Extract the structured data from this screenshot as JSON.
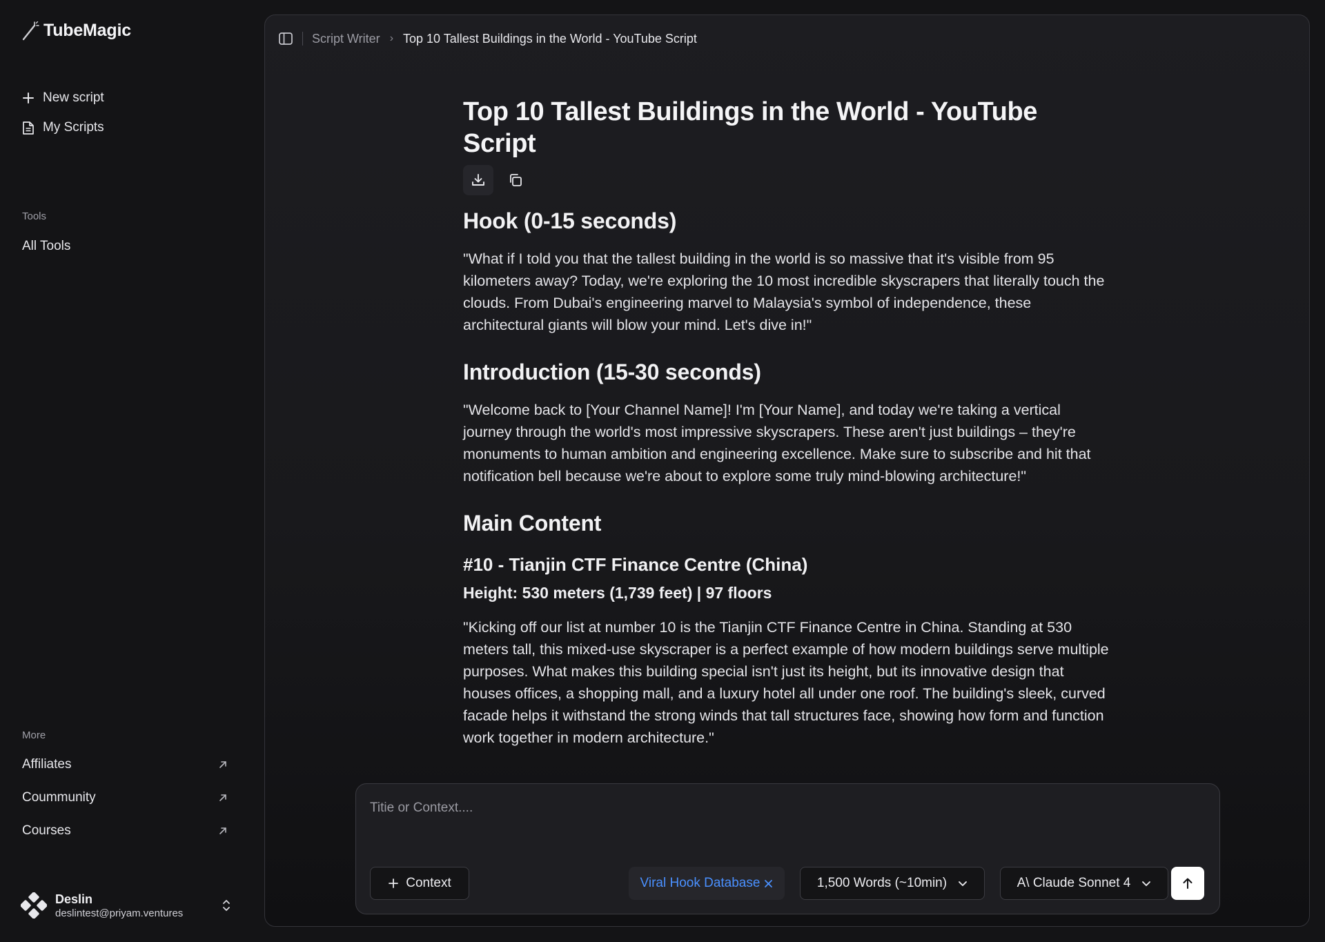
{
  "app": {
    "name": "TubeMagic"
  },
  "sidebar": {
    "new_script": "New script",
    "my_scripts": "My Scripts",
    "tools_label": "Tools",
    "all_tools": "All Tools",
    "more_label": "More",
    "more_items": [
      "Affiliates",
      "Coummunity",
      "Courses"
    ]
  },
  "user": {
    "name": "Deslin",
    "email": "deslintest@priyam.ventures"
  },
  "breadcrumb": {
    "parent": "Script Writer",
    "current": "Top 10 Tallest Buildings in the World - YouTube Script"
  },
  "document": {
    "title": "Top 10 Tallest Buildings in the World - YouTube Script",
    "sections": [
      {
        "heading": "Hook (0-15 seconds)",
        "body": "\"What if I told you that the tallest building in the world is so massive that it's visible from 95 kilometers away? Today, we're exploring the 10 most incredible skyscrapers that literally touch the clouds. From Dubai's engineering marvel to Malaysia's symbol of independence, these architectural giants will blow your mind. Let's dive in!\""
      },
      {
        "heading": "Introduction (15-30 seconds)",
        "body": "\"Welcome back to [Your Channel Name]! I'm [Your Name], and today we're taking a vertical journey through the world's most impressive skyscrapers. These aren't just buildings – they're monuments to human ambition and engineering excellence. Make sure to subscribe and hit that notification bell because we're about to explore some truly mind-blowing architecture!\""
      },
      {
        "heading": "Main Content"
      }
    ],
    "item": {
      "title": "#10 - Tianjin CTF Finance Centre (China)",
      "meta": "Height: 530 meters (1,739 feet) | 97 floors",
      "body": "\"Kicking off our list at number 10 is the Tianjin CTF Finance Centre in China. Standing at 530 meters tall, this mixed-use skyscraper is a perfect example of how modern buildings serve multiple purposes. What makes this building special isn't just its height, but its innovative design that houses offices, a shopping mall, and a luxury hotel all under one roof. The building's sleek, curved facade helps it withstand the strong winds that tall structures face, showing how form and function work together in modern architecture.\""
    }
  },
  "composer": {
    "placeholder": "Titie or Context....",
    "context_label": "Context",
    "tag_label": "Viral Hook Database",
    "length_label": "1,500 Words (~10min)",
    "model_label": "A\\ Claude Sonnet 4"
  },
  "colors": {
    "accent_blue": "#4a90ff",
    "background": "#141416",
    "panel": "#1d1d21"
  }
}
